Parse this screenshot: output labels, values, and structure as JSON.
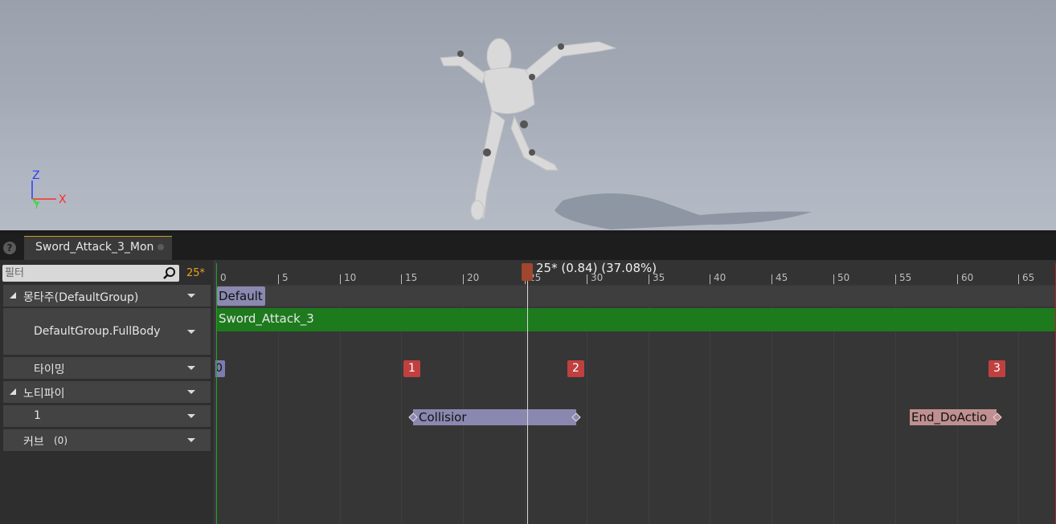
{
  "viewport": {
    "axis_labels": {
      "z": "Z",
      "x": "X",
      "y": "Y"
    },
    "colors": {
      "z": "#2a3cff",
      "x": "#ff2a2a",
      "y": "#2adf2a"
    }
  },
  "tab": {
    "title": "Sword_Attack_3_Mon"
  },
  "filter": {
    "placeholder": "필터",
    "frame": "25*"
  },
  "tracks": {
    "montage": "몽타주(DefaultGroup)",
    "slot": "DefaultGroup.FullBody",
    "timing": "타이밍",
    "notifies": "노티파이",
    "notify_track": "1",
    "curves": "커브",
    "curves_count": "(0)"
  },
  "timeline": {
    "ticks": [
      "0",
      "5",
      "10",
      "15",
      "20",
      "25",
      "30",
      "35",
      "40",
      "45",
      "50",
      "55",
      "60",
      "65"
    ],
    "playhead": "25* (0.84) (37.08%)",
    "section": "Default",
    "segment": "Sword_Attack_3",
    "timing_markers": [
      "0",
      "1",
      "2",
      "3"
    ],
    "notifies": [
      {
        "label": "Collisior",
        "color": "#8a88b0"
      },
      {
        "label": "End_DoActio",
        "color": "#c09090"
      }
    ]
  }
}
